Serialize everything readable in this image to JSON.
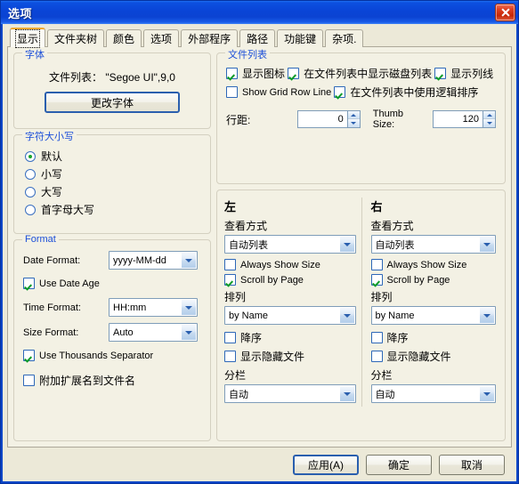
{
  "window": {
    "title": "选项",
    "close_icon": "close-icon",
    "accent_titlebar": "#0a44d6",
    "client_bg": "#ece9d8",
    "group_title_color": "#1c4fd8",
    "active_tab_accent": "#f0a830",
    "check_color": "#0a9b28"
  },
  "tabs": [
    {
      "label": "显示",
      "active": true
    },
    {
      "label": "文件夹树",
      "active": false
    },
    {
      "label": "颜色",
      "active": false
    },
    {
      "label": "选项",
      "active": false
    },
    {
      "label": "外部程序",
      "active": false
    },
    {
      "label": "路径",
      "active": false
    },
    {
      "label": "功能键",
      "active": false
    },
    {
      "label": "杂项.",
      "active": false
    }
  ],
  "font_group": {
    "title": "字体",
    "file_list_label": "文件列表：  \"Segoe UI\",9,0",
    "change_font_button": "更改字体"
  },
  "case_group": {
    "title": "字符大小写",
    "options": [
      {
        "label": "默认",
        "selected": true
      },
      {
        "label": "小写",
        "selected": false
      },
      {
        "label": "大写",
        "selected": false
      },
      {
        "label": "首字母大写",
        "selected": false
      }
    ]
  },
  "format_group": {
    "title": "Format",
    "date_format_label": "Date Format:",
    "date_format_value": "yyyy-MM-dd",
    "use_date_age_label": "Use Date Age",
    "use_date_age_checked": true,
    "time_format_label": "Time Format:",
    "time_format_value": "HH:mm",
    "size_format_label": "Size Format:",
    "size_format_value": "Auto",
    "use_thousands_label": "Use Thousands Separator",
    "use_thousands_checked": true,
    "append_ext_label": "附加扩展名到文件名",
    "append_ext_checked": false
  },
  "filelist_group": {
    "title": "文件列表",
    "checks": [
      {
        "label": "显示图标",
        "checked": true
      },
      {
        "label": "在文件列表中显示磁盘列表",
        "checked": true
      },
      {
        "label": "显示列线",
        "checked": true
      },
      {
        "label": "Show Grid Row Line",
        "checked": false
      },
      {
        "label": "在文件列表中使用逻辑排序",
        "checked": true
      }
    ],
    "row_spacing_label": "行距:",
    "row_spacing_value": "0",
    "thumb_size_label": "Thumb Size:",
    "thumb_size_value": "120"
  },
  "panes": [
    {
      "title": "左",
      "view_mode_label": "查看方式",
      "view_mode_value": "自动列表",
      "always_show_size_label": "Always Show Size",
      "always_show_size_checked": false,
      "scroll_by_page_label": "Scroll by Page",
      "scroll_by_page_checked": true,
      "sort_label": "排列",
      "sort_value": "by Name",
      "descending_label": "降序",
      "descending_checked": false,
      "show_hidden_label": "显示隐藏文件",
      "show_hidden_checked": false,
      "columns_label": "分栏",
      "columns_value": "自动"
    },
    {
      "title": "右",
      "view_mode_label": "查看方式",
      "view_mode_value": "自动列表",
      "always_show_size_label": "Always Show Size",
      "always_show_size_checked": false,
      "scroll_by_page_label": "Scroll by Page",
      "scroll_by_page_checked": true,
      "sort_label": "排列",
      "sort_value": "by Name",
      "descending_label": "降序",
      "descending_checked": false,
      "show_hidden_label": "显示隐藏文件",
      "show_hidden_checked": false,
      "columns_label": "分栏",
      "columns_value": "自动"
    }
  ],
  "footer": {
    "apply_label": "应用(A)",
    "ok_label": "确定",
    "cancel_label": "取消"
  }
}
